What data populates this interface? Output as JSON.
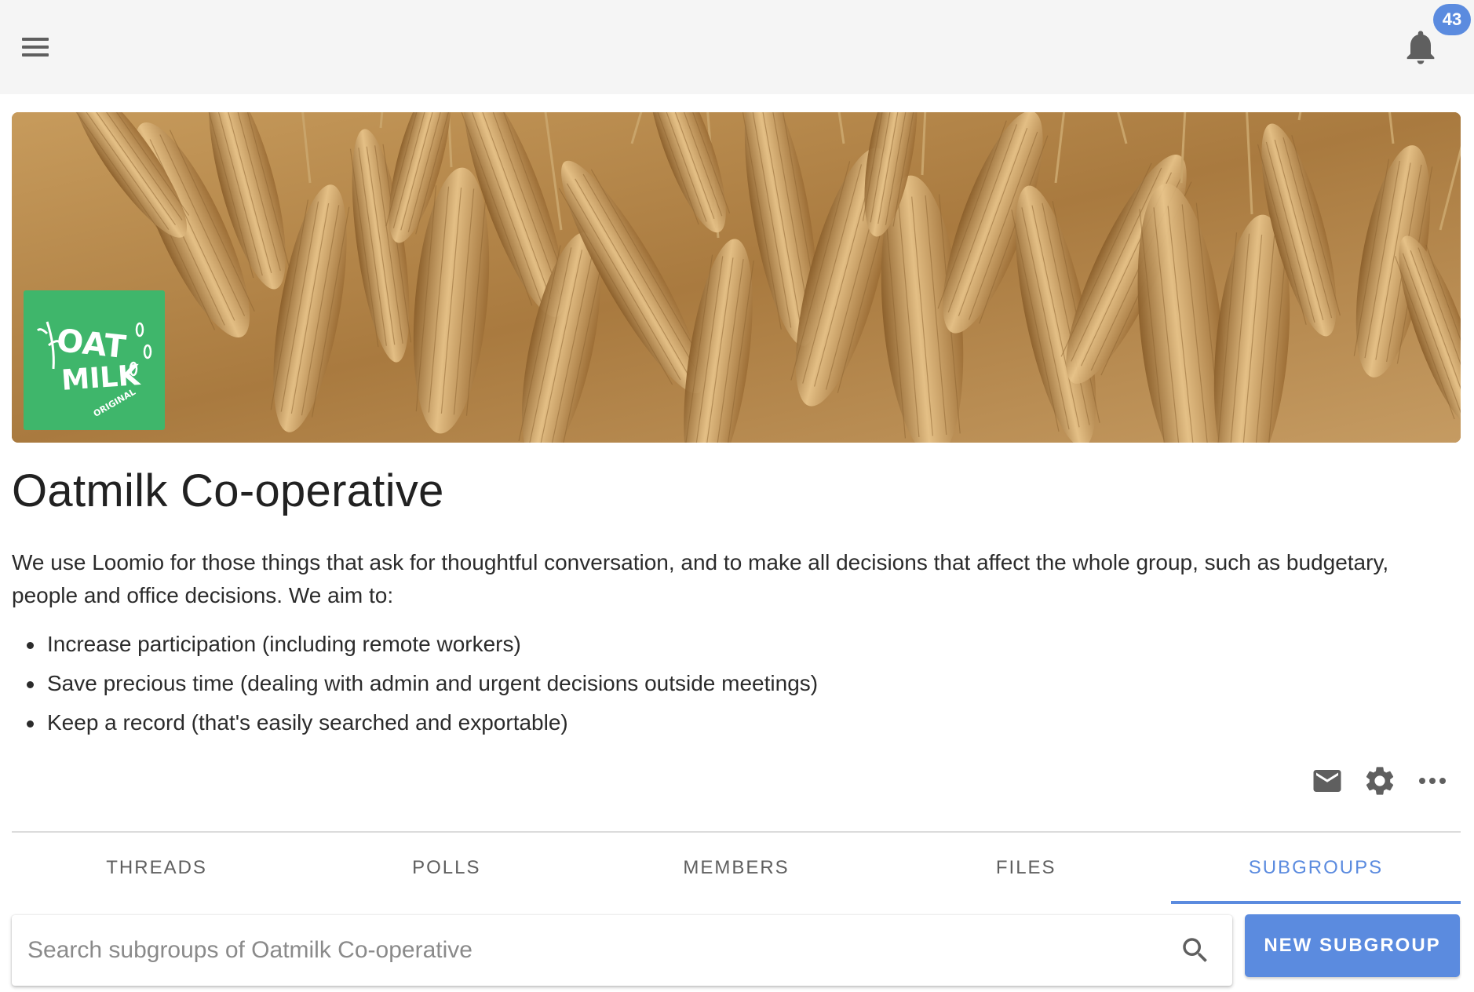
{
  "topbar": {
    "menu_icon": "hamburger-menu-icon",
    "notifications_icon": "bell-icon",
    "notifications_count": "43"
  },
  "group": {
    "logo_text": "OAT MILK ORIGINAL",
    "title": "Oatmilk Co-operative",
    "description": "We use Loomio for those things that ask for thoughtful conversation, and to make all decisions that affect the whole group, such as budgetary, people and office decisions. We aim to:",
    "goals": [
      "Increase participation (including remote workers)",
      "Save precious time (dealing with admin and urgent decisions outside meetings)",
      "Keep a record (that's easily searched and exportable)"
    ]
  },
  "actions": {
    "email_icon": "email-icon",
    "settings_icon": "gear-icon",
    "more_icon": "more-horizontal-icon"
  },
  "tabs": [
    {
      "label": "THREADS",
      "active": false
    },
    {
      "label": "POLLS",
      "active": false
    },
    {
      "label": "MEMBERS",
      "active": false
    },
    {
      "label": "FILES",
      "active": false
    },
    {
      "label": "SUBGROUPS",
      "active": true
    }
  ],
  "search": {
    "placeholder": "Search subgroups of Oatmilk Co-operative",
    "value": ""
  },
  "new_subgroup_label": "NEW SUBGROUP",
  "colors": {
    "accent": "#5b8bdf",
    "topbar": "#f5f5f5",
    "logo_bg": "#3fb66b",
    "cover_tone": "#b8894a"
  }
}
